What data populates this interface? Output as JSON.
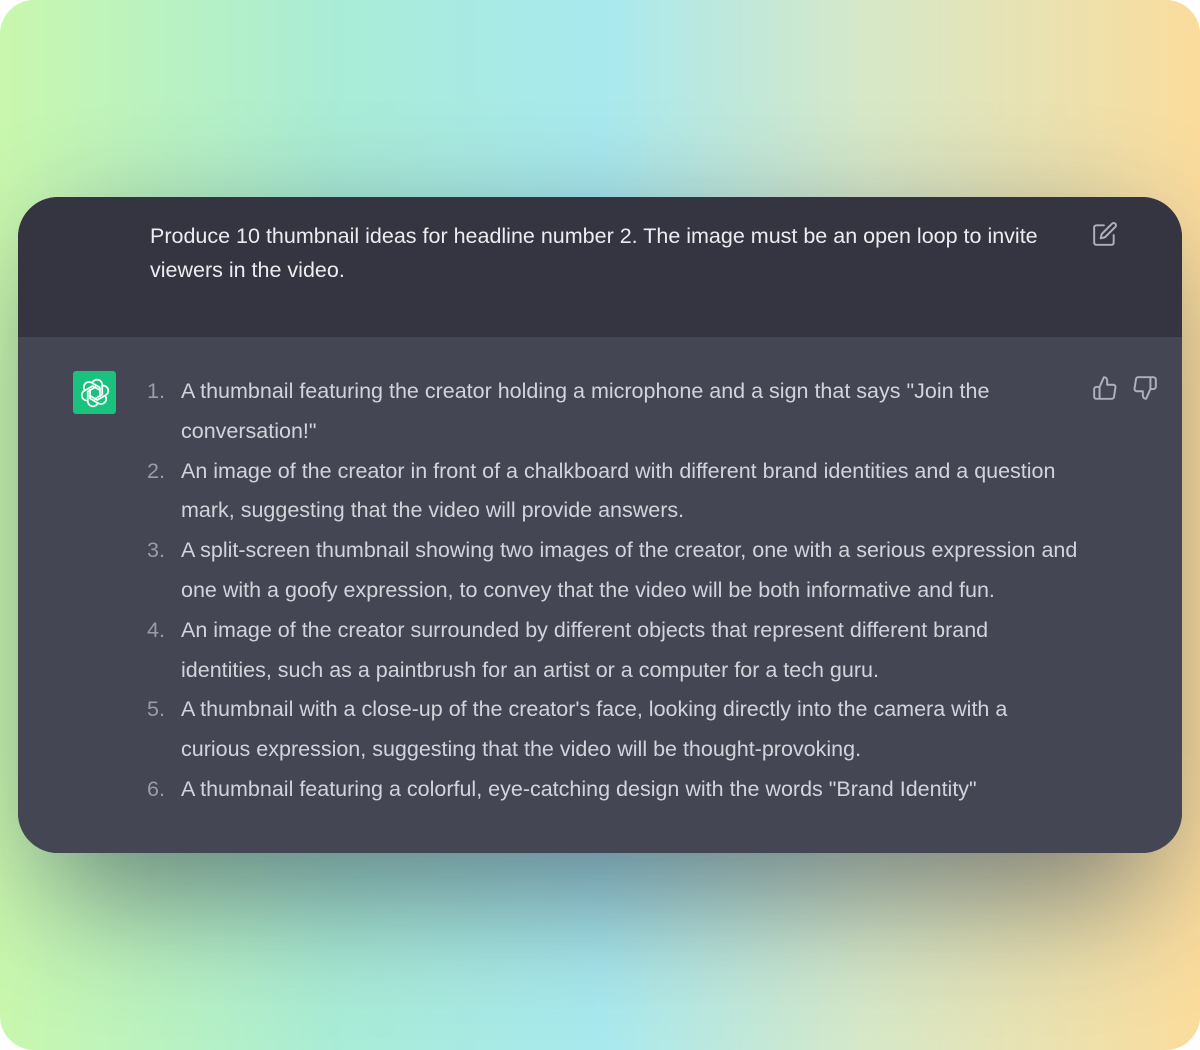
{
  "colors": {
    "user_bg": "#343541",
    "assistant_bg": "#444654",
    "avatar_bg": "#19c37d",
    "text": "#d1d5db",
    "icon": "#aeb0bd"
  },
  "user_message": {
    "text": "Produce 10 thumbnail ideas for headline number 2. The image must be an open loop to invite viewers in the video.",
    "edit_icon": "edit-icon"
  },
  "assistant_message": {
    "avatar_icon": "openai-logo-icon",
    "feedback_icons": [
      "thumbs-up-icon",
      "thumbs-down-icon"
    ],
    "items": [
      {
        "number": "1.",
        "text": "A thumbnail featuring the creator holding a microphone and a sign that says \"Join the conversation!\""
      },
      {
        "number": "2.",
        "text": "An image of the creator in front of a chalkboard with different brand identities and a question mark, suggesting that the video will provide answers."
      },
      {
        "number": "3.",
        "text": "A split-screen thumbnail showing two images of the creator, one with a serious expression and one with a goofy expression, to convey that the video will be both informative and fun."
      },
      {
        "number": "4.",
        "text": "An image of the creator surrounded by different objects that represent different brand identities, such as a paintbrush for an artist or a computer for a tech guru."
      },
      {
        "number": "5.",
        "text": "A thumbnail with a close-up of the creator's face, looking directly into the camera with a curious expression, suggesting that the video will be thought-provoking."
      },
      {
        "number": "6.",
        "text": "A thumbnail featuring a colorful, eye-catching design with the words \"Brand Identity\""
      }
    ]
  }
}
